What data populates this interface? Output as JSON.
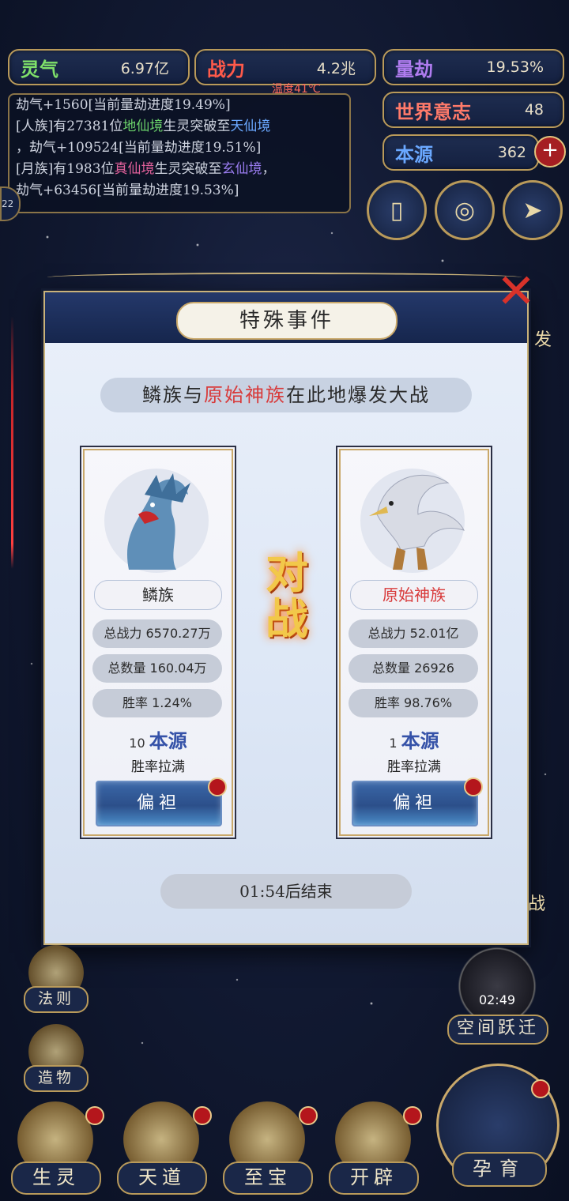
{
  "stats": {
    "lingqi": {
      "label": "灵气",
      "value": "6.97亿",
      "color": "#7fe06a"
    },
    "zhanli": {
      "label": "战力",
      "value": "4.2兆",
      "color": "#ff5a4a"
    },
    "liangjie": {
      "label": "量劫",
      "value": "19.53%",
      "color": "#b07cf0"
    },
    "shijie": {
      "label": "世界意志",
      "value": "48",
      "color": "#ff7a6a"
    },
    "benyuan": {
      "label": "本源",
      "value": "362",
      "color": "#6aa8ff"
    },
    "temperature": "温度41℃"
  },
  "log": {
    "line0": "劫气+1560[当前量劫进度19.49%]",
    "line1a": "[人族]有27381位",
    "line1b": "地仙境",
    "line1c": "生灵突破至",
    "line1d": "天仙境",
    "line2": "，劫气+109524[当前量劫进度19.51%]",
    "line3a": "[月族]有1983位",
    "line3b": "真仙境",
    "line3c": "生灵突破至",
    "line3d": "玄仙境",
    "line3e": "，",
    "line4": "劫气+63456[当前量劫进度19.53%]",
    "badge": "22"
  },
  "modal": {
    "title": "特殊事件",
    "headline_pre": "鳞族与",
    "headline_hl": "原始神族",
    "headline_post": "在此地爆发大战",
    "vs_top": "对",
    "vs_bottom": "战",
    "timer": "01:54后结束",
    "left": {
      "name": "鳞族",
      "power": "总战力 6570.27万",
      "count": "总数量 160.04万",
      "winrate": "胜率 1.24%",
      "bonus_num": "10",
      "bonus_label": "本源",
      "bonus_sub": "胜率拉满",
      "favor": "偏袒"
    },
    "right": {
      "name": "原始神族",
      "power": "总战力 52.01亿",
      "count": "总数量 26926",
      "winrate": "胜率 98.76%",
      "bonus_num": "1",
      "bonus_label": "本源",
      "bonus_sub": "胜率拉满",
      "favor": "偏袒"
    }
  },
  "side": {
    "fa_ze": "法则",
    "zao_wu": "造物",
    "right_edge_top": "发",
    "right_edge_mid": "战"
  },
  "space_jump": {
    "label": "空间跃迁",
    "time": "02:49"
  },
  "bottom_nav": [
    {
      "label": "生灵"
    },
    {
      "label": "天道"
    },
    {
      "label": "至宝"
    },
    {
      "label": "开辟"
    }
  ],
  "nurture": {
    "label": "孕育"
  }
}
